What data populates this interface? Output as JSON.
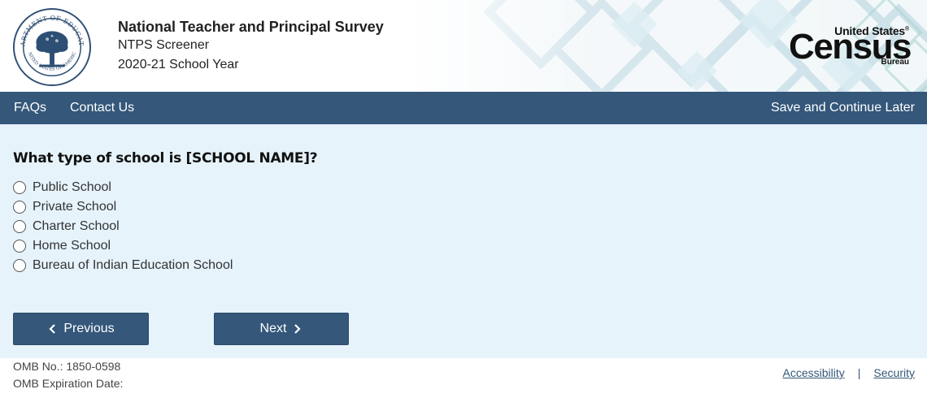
{
  "header": {
    "title": "National Teacher and Principal Survey",
    "subtitle": "NTPS Screener",
    "school_year": "2020-21 School Year",
    "seal_icon": "department-of-education-seal",
    "seal_text_top": "DEPARTMENT OF EDUCATION",
    "seal_text_bottom": "UNITED STATES OF AMERICA",
    "logo": {
      "line1": "United States",
      "line1_mark": "®",
      "line2": "Census",
      "line3": "Bureau"
    }
  },
  "nav": {
    "faqs": "FAQs",
    "contact": "Contact Us",
    "save_later": "Save and Continue Later"
  },
  "question": {
    "text": "What type of school is [SCHOOL NAME]?",
    "options": [
      "Public School",
      "Private School",
      "Charter School",
      "Home School",
      "Bureau of Indian Education School"
    ]
  },
  "buttons": {
    "previous": "Previous",
    "next": "Next"
  },
  "footer": {
    "omb_number": "OMB No.: 1850-0598",
    "omb_expiration": "OMB Expiration Date:",
    "accessibility": "Accessibility",
    "separator": "|",
    "security": "Security"
  },
  "colors": {
    "nav_bg": "#34577a",
    "main_bg": "#e6f3fb",
    "button_bg": "#34577a"
  }
}
